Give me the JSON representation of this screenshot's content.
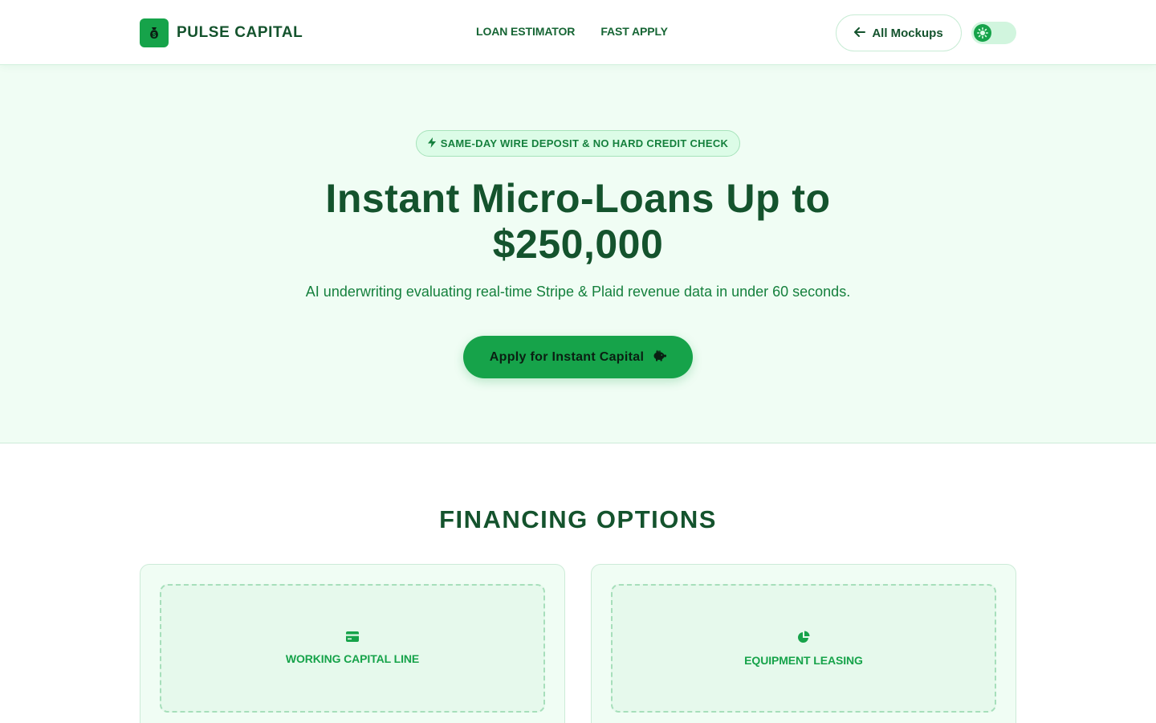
{
  "header": {
    "brand": "PULSE CAPITAL",
    "logo_icon": "money-bag-icon",
    "nav": [
      {
        "label": "LOAN ESTIMATOR"
      },
      {
        "label": "FAST APPLY"
      }
    ],
    "all_mockups_label": "All Mockups",
    "theme_toggle": {
      "state": "light",
      "icons": [
        "sun-icon",
        "moon-icon"
      ]
    }
  },
  "hero": {
    "badge": "SAME-DAY WIRE DEPOSIT & NO HARD CREDIT CHECK",
    "title_line1": "Instant Micro-Loans Up to",
    "title_line2": "$250,000",
    "subtitle": "AI underwriting evaluating real-time Stripe & Plaid revenue data in under 60 seconds.",
    "cta_label": "Apply for Instant Capital",
    "cta_icon": "piggy-bank-icon"
  },
  "financing": {
    "title": "FINANCING OPTIONS",
    "cards": [
      {
        "label": "WORKING CAPITAL LINE",
        "icon": "credit-card-icon"
      },
      {
        "label": "EQUIPMENT LEASING",
        "icon": "pie-chart-icon"
      }
    ]
  },
  "colors": {
    "primary": "#16a34a",
    "dark_green": "#14532d",
    "hero_bg": "#f0fdf4",
    "badge_bg": "#dcfce7"
  }
}
